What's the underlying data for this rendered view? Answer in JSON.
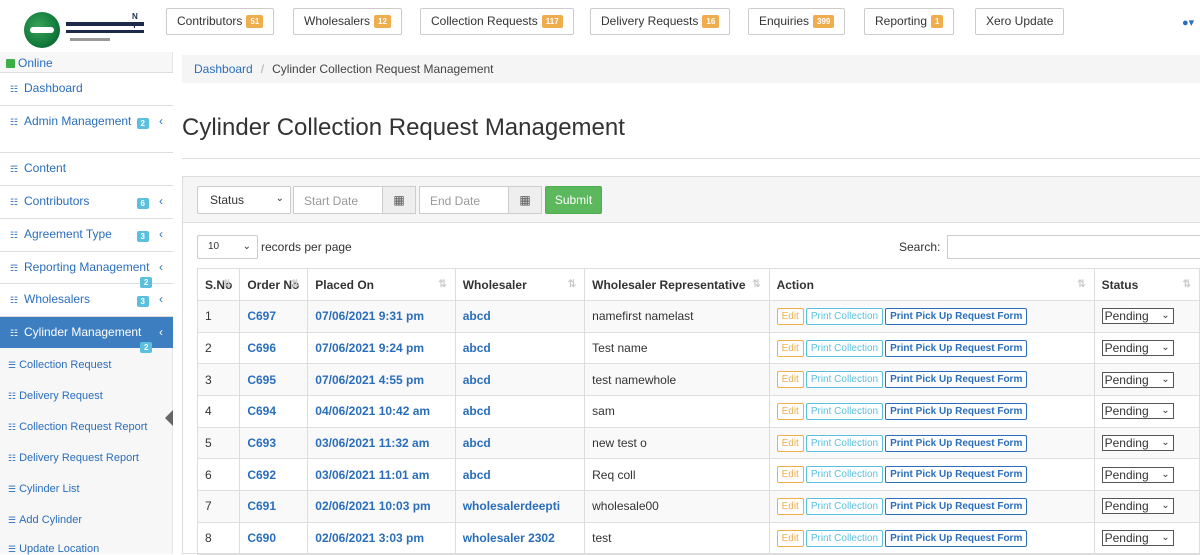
{
  "topnav": [
    {
      "label": "Contributors",
      "badge": "51"
    },
    {
      "label": "Wholesalers",
      "badge": "12"
    },
    {
      "label": "Collection Requests",
      "badge": "117"
    },
    {
      "label": "Delivery Requests",
      "badge": "16"
    },
    {
      "label": "Enquiries",
      "badge": "399"
    },
    {
      "label": "Reporting",
      "badge": "1"
    },
    {
      "label": "Xero Update",
      "badge": ""
    }
  ],
  "logo": {
    "text": "N T"
  },
  "sidebar": {
    "status": "Online",
    "items": [
      {
        "label": "Dashboard",
        "badge": "",
        "chevron": ""
      },
      {
        "label": "Admin Management",
        "badge": "2",
        "chevron": "‹"
      },
      {
        "label": "Content",
        "badge": "",
        "chevron": ""
      },
      {
        "label": "Contributors",
        "badge": "6",
        "chevron": "‹"
      },
      {
        "label": "Agreement Type",
        "badge": "3",
        "chevron": "‹"
      },
      {
        "label": "Reporting Management",
        "badge": "2",
        "chevron": "‹"
      },
      {
        "label": "Wholesalers",
        "badge": "3",
        "chevron": "‹"
      },
      {
        "label": "Cylinder Management",
        "badge": "2",
        "chevron": "‹"
      }
    ],
    "subitems": [
      {
        "label": "Collection Request"
      },
      {
        "label": "Delivery Request"
      },
      {
        "label": "Collection Request Report"
      },
      {
        "label": "Delivery Request Report"
      },
      {
        "label": "Cylinder List"
      },
      {
        "label": "Add Cylinder"
      },
      {
        "label": "Update Location"
      }
    ]
  },
  "breadcrumb": {
    "home": "Dashboard",
    "current": "Cylinder Collection Request Management"
  },
  "page_title": "Cylinder Collection Request Management",
  "filters": {
    "status_label": "Status",
    "start_placeholder": "Start Date",
    "end_placeholder": "End Date",
    "submit": "Submit"
  },
  "table_controls": {
    "page_length": "10",
    "records_text": "records per page",
    "search_label": "Search:"
  },
  "table": {
    "headers": [
      "S.No",
      "Order No",
      "Placed On",
      "Wholesaler",
      "Wholesaler Representative",
      "Action",
      "Status"
    ],
    "action_labels": {
      "edit": "Edit",
      "print_collection": "Print Collection",
      "print_form": "Print Pick Up Request Form"
    },
    "rows": [
      {
        "sno": "1",
        "order": "C697",
        "placed": "07/06/2021 9:31 pm",
        "wholesaler": "abcd",
        "rep": "namefirst namelast",
        "status": "Pending"
      },
      {
        "sno": "2",
        "order": "C696",
        "placed": "07/06/2021 9:24 pm",
        "wholesaler": "abcd",
        "rep": "Test name",
        "status": "Pending"
      },
      {
        "sno": "3",
        "order": "C695",
        "placed": "07/06/2021 4:55 pm",
        "wholesaler": "abcd",
        "rep": "test namewhole",
        "status": "Pending"
      },
      {
        "sno": "4",
        "order": "C694",
        "placed": "04/06/2021 10:42 am",
        "wholesaler": "abcd",
        "rep": "sam",
        "status": "Pending"
      },
      {
        "sno": "5",
        "order": "C693",
        "placed": "03/06/2021 11:32 am",
        "wholesaler": "abcd",
        "rep": "new test o",
        "status": "Pending"
      },
      {
        "sno": "6",
        "order": "C692",
        "placed": "03/06/2021 11:01 am",
        "wholesaler": "abcd",
        "rep": "Req coll",
        "status": "Pending"
      },
      {
        "sno": "7",
        "order": "C691",
        "placed": "02/06/2021 10:03 pm",
        "wholesaler": "wholesalerdeepti",
        "rep": "wholesale00",
        "status": "Pending"
      },
      {
        "sno": "8",
        "order": "C690",
        "placed": "02/06/2021 3:03 pm",
        "wholesaler": "wholesaler 2302",
        "rep": "test",
        "status": "Pending"
      }
    ]
  }
}
